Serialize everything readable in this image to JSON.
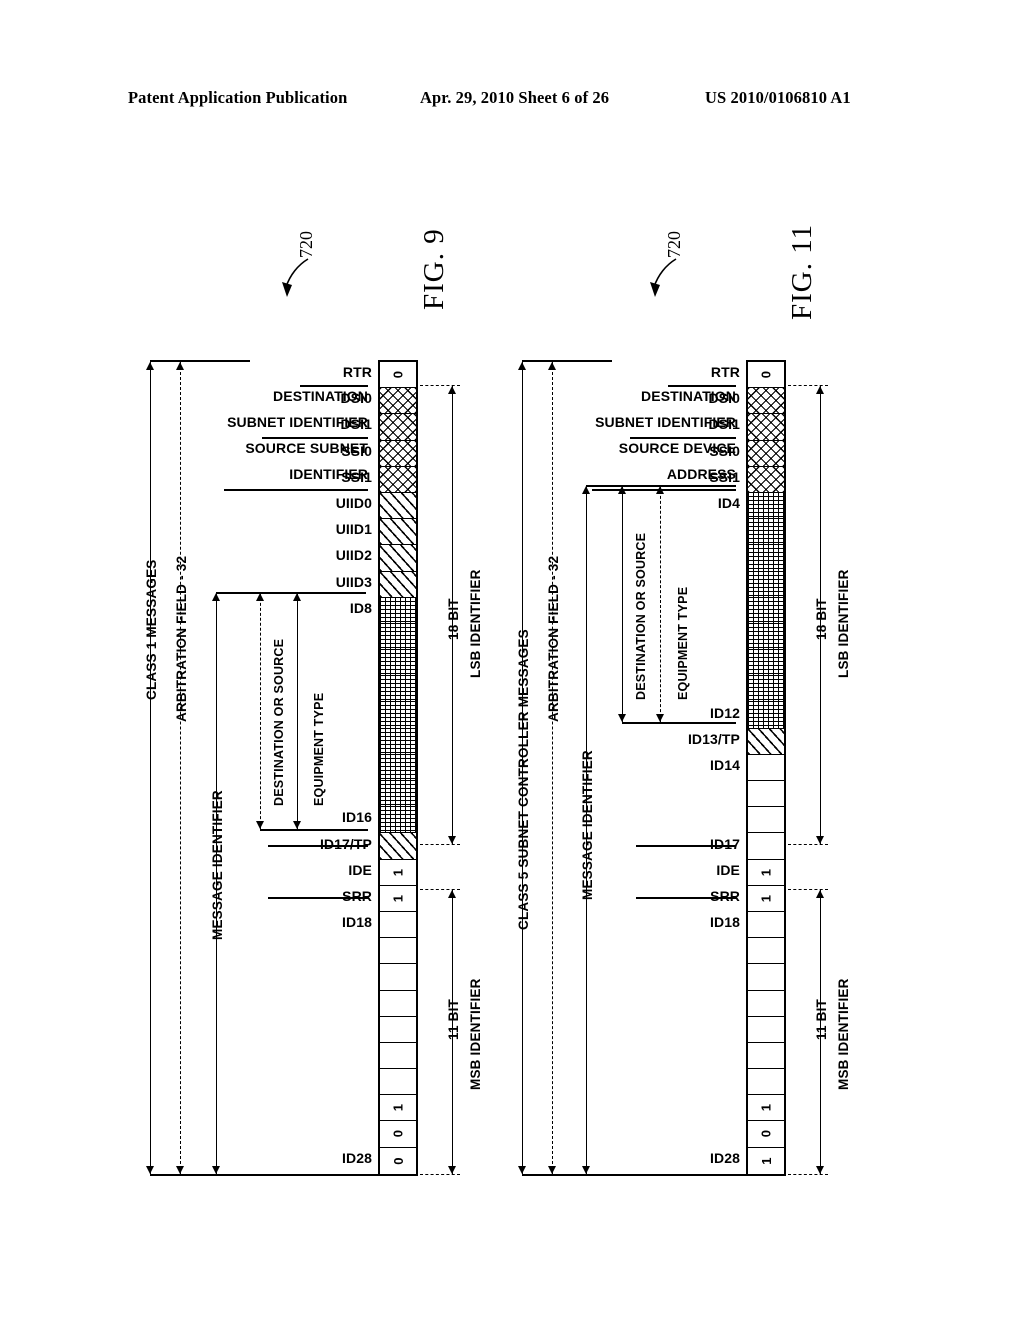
{
  "header": {
    "publication": "Patent Application Publication",
    "date_sheet": "Apr. 29, 2010  Sheet 6 of 26",
    "patent_number": "US 2010/0106810 A1"
  },
  "figures": [
    {
      "id": "fig9",
      "title": "FIG. 9",
      "reference_numeral": "720",
      "class_label": "CLASS 1 MESSAGES",
      "arbitration_label": "ARBITRATION FIELD - 32",
      "message_identifier_label": "MESSAGE IDENTIFIER",
      "inner_bracket_outer_label": "DESTINATION OR SOURCE",
      "inner_bracket_inner_label": "EQUIPMENT TYPE",
      "right_brackets": [
        {
          "line1": "18 BIT",
          "line2": "LSB IDENTIFIER"
        },
        {
          "line1": "11 BIT",
          "line2": "MSB IDENTIFIER"
        }
      ],
      "group_labels": [
        {
          "line1": "DESTINATION",
          "line2": "SUBNET IDENTIFIER"
        },
        {
          "line1": "SOURCE SUBNET",
          "line2": "IDENTIFIER"
        }
      ],
      "cells": [
        {
          "label": "RTR",
          "fill": "plain",
          "value": "0"
        },
        {
          "label": "DSI0",
          "fill": "cross",
          "value": ""
        },
        {
          "label": "DSI1",
          "fill": "cross",
          "value": ""
        },
        {
          "label": "SSI0",
          "fill": "cross",
          "value": ""
        },
        {
          "label": "SSI1",
          "fill": "cross",
          "value": ""
        },
        {
          "label": "UIID0",
          "fill": "diag",
          "value": ""
        },
        {
          "label": "UIID1",
          "fill": "diag",
          "value": ""
        },
        {
          "label": "UIID2",
          "fill": "diag",
          "value": ""
        },
        {
          "label": "UIID3",
          "fill": "diag",
          "value": ""
        },
        {
          "label": "ID8",
          "fill": "dot",
          "value": ""
        },
        {
          "label": "",
          "fill": "dot",
          "value": ""
        },
        {
          "label": "",
          "fill": "dot",
          "value": ""
        },
        {
          "label": "",
          "fill": "dot",
          "value": ""
        },
        {
          "label": "",
          "fill": "dot",
          "value": ""
        },
        {
          "label": "",
          "fill": "dot",
          "value": ""
        },
        {
          "label": "",
          "fill": "dot",
          "value": ""
        },
        {
          "label": "",
          "fill": "dot",
          "value": ""
        },
        {
          "label": "ID16",
          "fill": "dot",
          "value": ""
        },
        {
          "label": "ID17/TP",
          "fill": "diag",
          "value": ""
        },
        {
          "label": "IDE",
          "fill": "plain",
          "value": "1"
        },
        {
          "label": "SRR",
          "fill": "plain",
          "value": "1"
        },
        {
          "label": "ID18",
          "fill": "plain",
          "value": ""
        },
        {
          "label": "",
          "fill": "plain",
          "value": ""
        },
        {
          "label": "",
          "fill": "plain",
          "value": ""
        },
        {
          "label": "",
          "fill": "plain",
          "value": ""
        },
        {
          "label": "",
          "fill": "plain",
          "value": ""
        },
        {
          "label": "",
          "fill": "plain",
          "value": ""
        },
        {
          "label": "",
          "fill": "plain",
          "value": ""
        },
        {
          "label": "",
          "fill": "plain",
          "value": "1"
        },
        {
          "label": "",
          "fill": "plain",
          "value": "0"
        },
        {
          "label": "ID28",
          "fill": "plain",
          "value": "0"
        }
      ]
    },
    {
      "id": "fig11",
      "title": "FIG. 11",
      "reference_numeral": "720",
      "class_label": "CLASS 5 SUBNET CONTROLLER MESSAGES",
      "arbitration_label": "ARBITRATION FIELD - 32",
      "message_identifier_label": "MESSAGE IDENTIFIER",
      "inner_bracket_outer_label": "DESTINATION OR SOURCE",
      "inner_bracket_inner_label": "EQUIPMENT TYPE",
      "right_brackets": [
        {
          "line1": "18 BIT",
          "line2": "LSB IDENTIFIER"
        },
        {
          "line1": "11 BIT",
          "line2": "MSB IDENTIFIER"
        }
      ],
      "group_labels": [
        {
          "line1": "DESTINATION",
          "line2": "SUBNET IDENTIFIER"
        },
        {
          "line1": "SOURCE DEVICE",
          "line2": "ADDRESS"
        }
      ],
      "cells": [
        {
          "label": "RTR",
          "fill": "plain",
          "value": "0"
        },
        {
          "label": "DSI0",
          "fill": "cross",
          "value": ""
        },
        {
          "label": "DSI1",
          "fill": "cross",
          "value": ""
        },
        {
          "label": "SSI0",
          "fill": "cross",
          "value": ""
        },
        {
          "label": "SSI1",
          "fill": "cross",
          "value": ""
        },
        {
          "label": "ID4",
          "fill": "dot",
          "value": ""
        },
        {
          "label": "",
          "fill": "dot",
          "value": ""
        },
        {
          "label": "",
          "fill": "dot",
          "value": ""
        },
        {
          "label": "",
          "fill": "dot",
          "value": ""
        },
        {
          "label": "",
          "fill": "dot",
          "value": ""
        },
        {
          "label": "",
          "fill": "dot",
          "value": ""
        },
        {
          "label": "",
          "fill": "dot",
          "value": ""
        },
        {
          "label": "",
          "fill": "dot",
          "value": ""
        },
        {
          "label": "ID12",
          "fill": "dot",
          "value": ""
        },
        {
          "label": "ID13/TP",
          "fill": "diag",
          "value": ""
        },
        {
          "label": "ID14",
          "fill": "plain",
          "value": ""
        },
        {
          "label": "",
          "fill": "plain",
          "value": ""
        },
        {
          "label": "",
          "fill": "plain",
          "value": ""
        },
        {
          "label": "ID17",
          "fill": "plain",
          "value": ""
        },
        {
          "label": "IDE",
          "fill": "plain",
          "value": "1"
        },
        {
          "label": "SRR",
          "fill": "plain",
          "value": "1"
        },
        {
          "label": "ID18",
          "fill": "plain",
          "value": ""
        },
        {
          "label": "",
          "fill": "plain",
          "value": ""
        },
        {
          "label": "",
          "fill": "plain",
          "value": ""
        },
        {
          "label": "",
          "fill": "plain",
          "value": ""
        },
        {
          "label": "",
          "fill": "plain",
          "value": ""
        },
        {
          "label": "",
          "fill": "plain",
          "value": ""
        },
        {
          "label": "",
          "fill": "plain",
          "value": ""
        },
        {
          "label": "",
          "fill": "plain",
          "value": "1"
        },
        {
          "label": "",
          "fill": "plain",
          "value": "0"
        },
        {
          "label": "ID28",
          "fill": "plain",
          "value": "1"
        }
      ]
    }
  ]
}
